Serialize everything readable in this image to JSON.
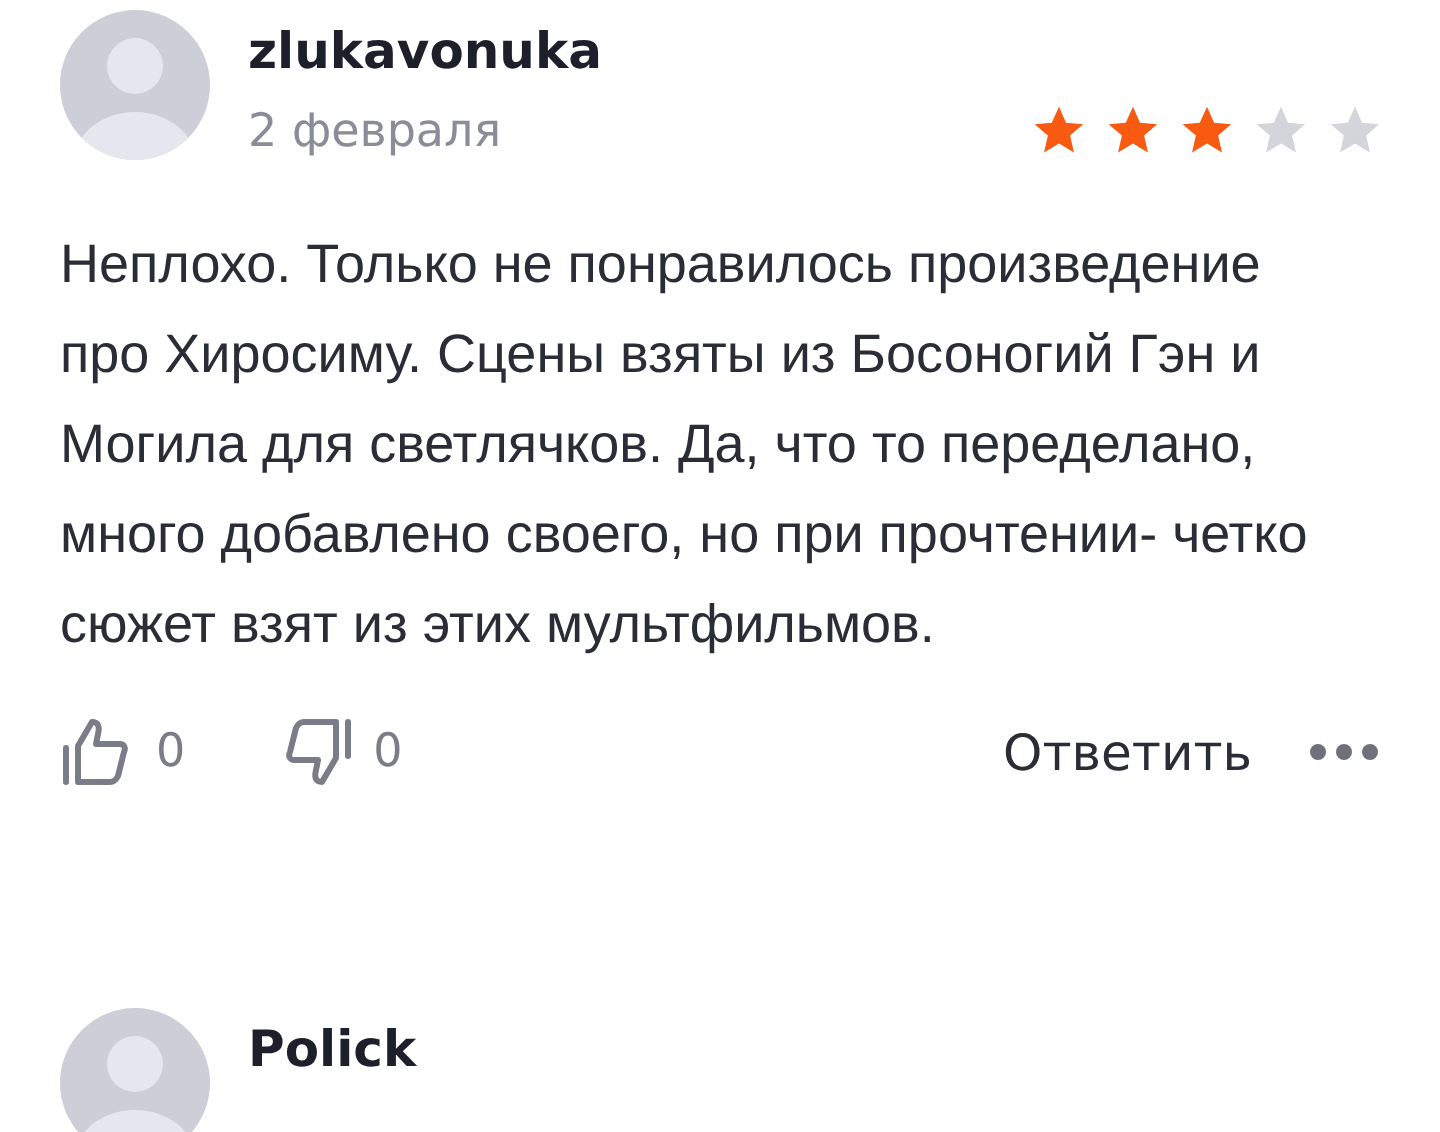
{
  "reviews": [
    {
      "author": "zlukavonuka",
      "date": "2 февраля",
      "stars": 3,
      "text": "Неплохо. Только не понравилось произведение про Хиросиму. Сцены взяты из Босоногий Гэн и Могила для светлячков. Да, что то переделано, много добавлено своего, но при прочтении- четко сюжет взят из этих мультфильмов.",
      "likes": "0",
      "dislikes": "0",
      "reply": "Ответить"
    },
    {
      "author": "Polick"
    }
  ]
}
